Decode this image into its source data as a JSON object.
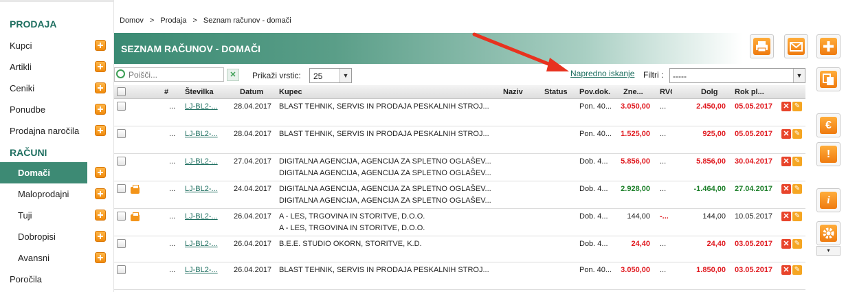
{
  "sidebar": {
    "section_prodaja": "PRODAJA",
    "section_racuni": "RAČUNI",
    "items": [
      {
        "label": "Kupci"
      },
      {
        "label": "Artikli"
      },
      {
        "label": "Ceniki"
      },
      {
        "label": "Ponudbe"
      },
      {
        "label": "Prodajna naročila"
      }
    ],
    "racuni_items": [
      {
        "label": "Domači"
      },
      {
        "label": "Maloprodajni"
      },
      {
        "label": "Tuji"
      },
      {
        "label": "Dobropisi"
      },
      {
        "label": "Avansni"
      }
    ],
    "porocila": "Poročila"
  },
  "breadcrumb": [
    "Domov",
    ">",
    "Prodaja",
    ">",
    "Seznam računov - domači"
  ],
  "title": "SEZNAM RAČUNOV - DOMAČI",
  "toolbar": {
    "search_placeholder": "Poišči...",
    "clear_label": "✕",
    "rows_label": "Prikaži vrstic:",
    "rows_value": "25",
    "advanced_search": "Napredno iskanje",
    "filter_label": "Filtri :",
    "filter_value": "-----"
  },
  "columns": [
    "#",
    "Številka",
    "Datum",
    "Kupec",
    "Naziv",
    "Status",
    "Pov.dok.",
    "Zne...",
    "RVO",
    "Dolg",
    "Rok pl..."
  ],
  "rows": [
    {
      "num": "...",
      "stevilka": "LJ-BL2-...",
      "datum": "28.04.2017",
      "kupec1": "BLAST TEHNIK, SERVIS IN PRODAJA PESKALNIH STROJ...",
      "kupec2": "",
      "povdok": "Pon. 40...",
      "znesek": "3.050,00",
      "znesek_color": "red",
      "rvo": "...",
      "dolg": "2.450,00",
      "dolg_color": "red",
      "rok": "05.05.2017",
      "rok_color": "red",
      "print": false
    },
    {
      "num": "...",
      "stevilka": "LJ-BL2-...",
      "datum": "28.04.2017",
      "kupec1": "BLAST TEHNIK, SERVIS IN PRODAJA PESKALNIH STROJ...",
      "kupec2": "",
      "povdok": "Pon. 40...",
      "znesek": "1.525,00",
      "znesek_color": "red",
      "rvo": "...",
      "dolg": "925,00",
      "dolg_color": "red",
      "rok": "05.05.2017",
      "rok_color": "red",
      "print": false
    },
    {
      "num": "...",
      "stevilka": "LJ-BL2-...",
      "datum": "27.04.2017",
      "kupec1": "DIGITALNA AGENCIJA, AGENCIJA ZA SPLETNO OGLAŠEV...",
      "kupec2": "DIGITALNA AGENCIJA, AGENCIJA ZA SPLETNO OGLAŠEV...",
      "povdok": "Dob. 4...",
      "znesek": "5.856,00",
      "znesek_color": "red",
      "rvo": "...",
      "dolg": "5.856,00",
      "dolg_color": "red",
      "rok": "30.04.2017",
      "rok_color": "red",
      "print": false
    },
    {
      "num": "...",
      "stevilka": "LJ-BL2-...",
      "datum": "24.04.2017",
      "kupec1": "DIGITALNA AGENCIJA, AGENCIJA ZA SPLETNO OGLAŠEV...",
      "kupec2": "DIGITALNA AGENCIJA, AGENCIJA ZA SPLETNO OGLAŠEV...",
      "povdok": "Dob. 4...",
      "znesek": "2.928,00",
      "znesek_color": "green",
      "rvo": "...",
      "dolg": "-1.464,00",
      "dolg_color": "green",
      "rok": "27.04.2017",
      "rok_color": "green",
      "print": true
    },
    {
      "num": "...",
      "stevilka": "LJ-BL2-...",
      "datum": "26.04.2017",
      "kupec1": "A - LES, TRGOVINA IN STORITVE, D.O.O.",
      "kupec2": "A - LES, TRGOVINA IN STORITVE, D.O.O.",
      "povdok": "Dob. 4...",
      "znesek": "144,00",
      "znesek_color": "plain",
      "rvo": "-...",
      "dolg": "144,00",
      "dolg_color": "plain",
      "rok": "10.05.2017",
      "rok_color": "plain",
      "print": true
    },
    {
      "num": "...",
      "stevilka": "LJ-BL2-...",
      "datum": "26.04.2017",
      "kupec1": "B.E.E. STUDIO OKORN, STORITVE, K.D.",
      "kupec2": "",
      "povdok": "Dob. 4...",
      "znesek": "24,40",
      "znesek_color": "red",
      "rvo": "...",
      "dolg": "24,40",
      "dolg_color": "red",
      "rok": "03.05.2017",
      "rok_color": "red",
      "print": false
    },
    {
      "num": "...",
      "stevilka": "LJ-BL2-...",
      "datum": "26.04.2017",
      "kupec1": "BLAST TEHNIK, SERVIS IN PRODAJA PESKALNIH STROJ...",
      "kupec2": "",
      "povdok": "Pon. 40...",
      "znesek": "3.050,00",
      "znesek_color": "red",
      "rvo": "...",
      "dolg": "1.850,00",
      "dolg_color": "red",
      "rok": "03.05.2017",
      "rok_color": "red",
      "print": false
    }
  ],
  "right_buttons": [
    {
      "icon": "print-icon"
    },
    {
      "icon": "email-icon"
    },
    {
      "icon": "add-icon"
    },
    {
      "icon": "copy-icon"
    },
    {
      "icon": "euro-icon"
    },
    {
      "icon": "warning-icon"
    },
    {
      "icon": "info-icon"
    },
    {
      "icon": "settings-icon"
    }
  ],
  "colors": {
    "accent": "#3d8a74",
    "red": "#e0191f",
    "green": "#1c7f29",
    "orange": "#f08a0c"
  }
}
